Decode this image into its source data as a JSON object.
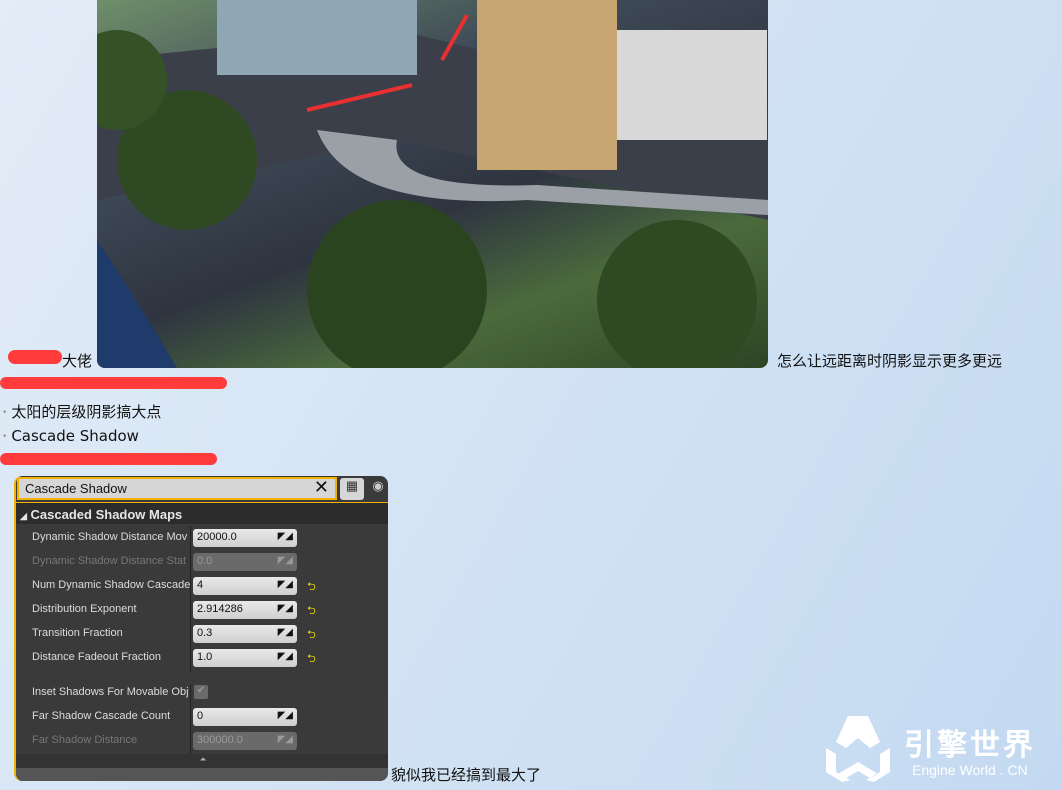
{
  "chat": {
    "line1_prefix": "大佬",
    "line1_suffix": "怎么让远距离时阴影显示更多更远",
    "bullets": [
      "太阳的层级阴影搞大点",
      "Cascade Shadow"
    ],
    "reply": "貌似我已经搞到最大了"
  },
  "panel": {
    "search_value": "Cascade Shadow",
    "section": "Cascaded Shadow Maps",
    "rows": [
      {
        "label": "Dynamic Shadow Distance Mov",
        "value": "20000.0"
      },
      {
        "label": "Dynamic Shadow Distance Stat",
        "value": "0.0"
      },
      {
        "label": "Num Dynamic Shadow Cascade",
        "value": "4"
      },
      {
        "label": "Distribution Exponent",
        "value": "2.914286"
      },
      {
        "label": "Transition Fraction",
        "value": "0.3"
      },
      {
        "label": "Distance Fadeout Fraction",
        "value": "1.0"
      },
      {
        "label": "Inset Shadows For Movable Obj",
        "value": "checked"
      },
      {
        "label": "Far Shadow Cascade Count",
        "value": "0"
      },
      {
        "label": "Far Shadow Distance",
        "value": "300000.0"
      }
    ]
  },
  "watermark": {
    "name": "引擎世界",
    "sub": "Engine World . CN"
  },
  "colors": {
    "accent": "#f0b400",
    "scribble": "#ff3b3b"
  }
}
